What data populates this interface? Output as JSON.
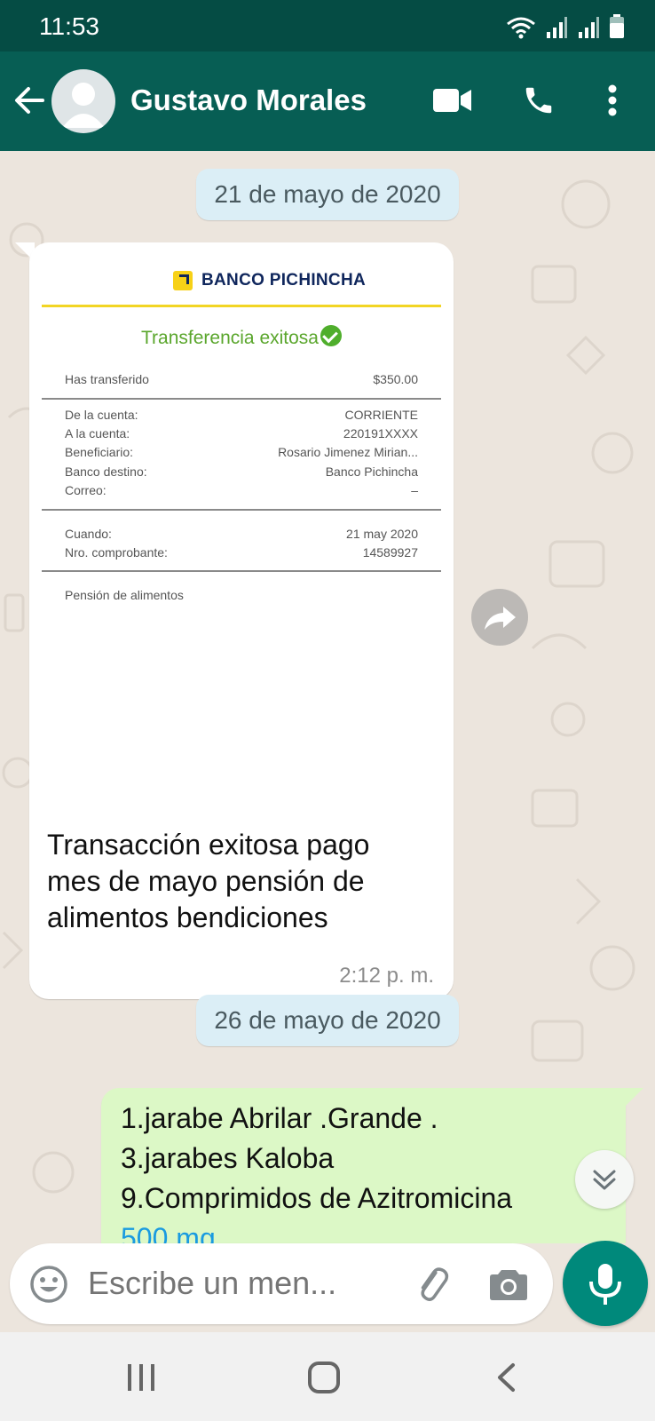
{
  "status_bar": {
    "time": "11:53"
  },
  "header": {
    "contact_name": "Gustavo Morales"
  },
  "date_separators": [
    "21 de mayo de 2020",
    "26 de mayo de 2020"
  ],
  "incoming_message": {
    "receipt": {
      "bank_name": "BANCO PICHINCHA",
      "success_title": "Transferencia exitosa",
      "transferred_label": "Has transferido",
      "transferred_amount": "$350.00",
      "details": [
        {
          "label": "De la cuenta:",
          "value": "CORRIENTE"
        },
        {
          "label": "A la cuenta:",
          "value": "220191XXXX"
        },
        {
          "label": "Beneficiario:",
          "value": "Rosario Jimenez Mirian..."
        },
        {
          "label": "Banco destino:",
          "value": "Banco Pichincha"
        },
        {
          "label": "Correo:",
          "value": "–"
        }
      ],
      "when_label": "Cuando:",
      "when_value": "21 may 2020",
      "voucher_label": "Nro. comprobante:",
      "voucher_value": "14589927",
      "concept": "Pensión de alimentos"
    },
    "caption_lines": [
      "Transacción exitosa pago",
      "mes de mayo pensión de",
      "alimentos bendiciones"
    ],
    "time": "2:12 p. m."
  },
  "outgoing_message": {
    "lines": [
      "1.jarabe Abrilar .Grande .",
      "3.jarabes Kaloba",
      "9.Comprimidos de Azitromicina"
    ],
    "link_text": "500 mg"
  },
  "composer": {
    "placeholder": "Escribe un men..."
  },
  "colors": {
    "header": "#075e54",
    "status_bar": "#054c44",
    "chat_bg": "#ece5dd",
    "outgoing_bubble": "#dcf8c6",
    "date_pill": "#dbeef6",
    "mic_button": "#00897b"
  },
  "icons": [
    "back-arrow-icon",
    "avatar-icon",
    "video-call-icon",
    "phone-icon",
    "more-vert-icon",
    "forward-icon",
    "chevron-down-icon",
    "emoji-icon",
    "attach-icon",
    "camera-icon",
    "mic-icon",
    "nav-recents-icon",
    "nav-home-icon",
    "nav-back-icon",
    "wifi-icon",
    "signal-icon",
    "battery-icon"
  ]
}
